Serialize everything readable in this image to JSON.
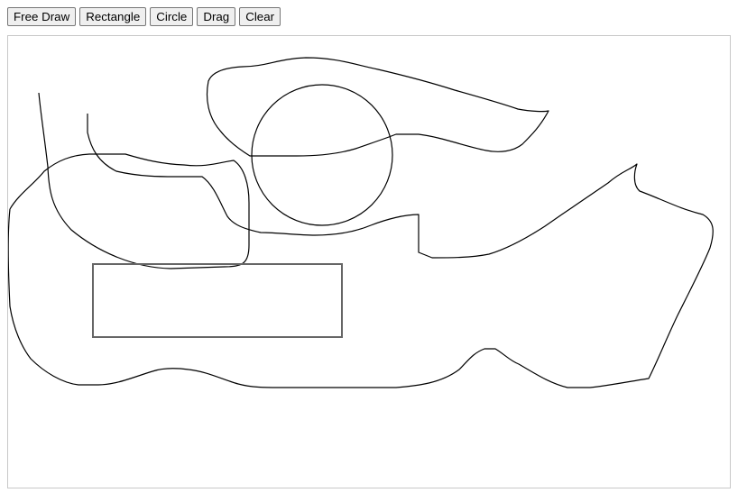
{
  "toolbar": {
    "buttons": [
      {
        "key": "free_draw",
        "label": "Free Draw"
      },
      {
        "key": "rectangle",
        "label": "Rectangle"
      },
      {
        "key": "circle",
        "label": "Circle"
      },
      {
        "key": "drag",
        "label": "Drag"
      },
      {
        "key": "clear",
        "label": "Clear"
      }
    ]
  },
  "canvas": {
    "stroke_color": "#000000",
    "rect_stroke_color": "#666666",
    "background": "#ffffff",
    "border_color": "#c8c8c8"
  }
}
